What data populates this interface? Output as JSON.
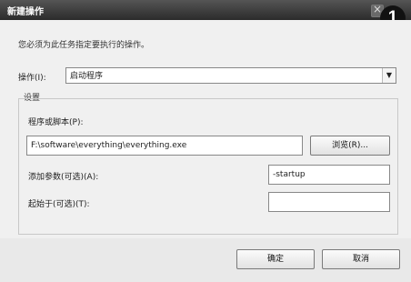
{
  "window": {
    "title": "新建操作"
  },
  "badge": "1",
  "description": "您必须为此任务指定要执行的操作。",
  "action": {
    "label": "操作(I):",
    "value": "启动程序"
  },
  "settings": {
    "group_label": "设置",
    "program_label": "程序或脚本(P):",
    "program_value": "F:\\software\\everything\\everything.exe",
    "browse_label": "浏览(R)...",
    "args_label": "添加参数(可选)(A):",
    "args_value": "-startup",
    "start_in_label": "起始于(可选)(T):",
    "start_in_value": ""
  },
  "buttons": {
    "ok": "确定",
    "cancel": "取消"
  }
}
